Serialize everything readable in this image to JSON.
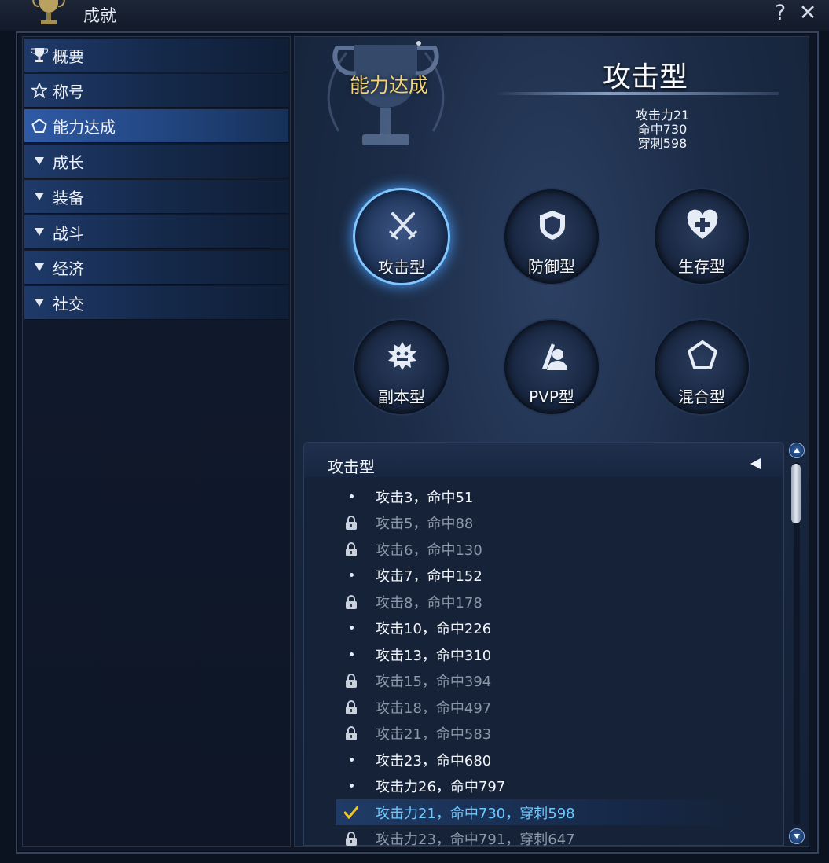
{
  "window": {
    "title": "成就",
    "help_label": "?",
    "close_label": "✕"
  },
  "sidebar": {
    "items": [
      {
        "label": "概要",
        "icon": "trophy-icon"
      },
      {
        "label": "称号",
        "icon": "star-icon"
      },
      {
        "label": "能力达成",
        "icon": "pentagon-icon",
        "active": true
      },
      {
        "label": "成长",
        "icon": "triangle-down-icon"
      },
      {
        "label": "装备",
        "icon": "triangle-down-icon"
      },
      {
        "label": "战斗",
        "icon": "triangle-down-icon"
      },
      {
        "label": "经济",
        "icon": "triangle-down-icon"
      },
      {
        "label": "社交",
        "icon": "triangle-down-icon"
      }
    ]
  },
  "header": {
    "section_name": "能力达成",
    "type_title": "攻击型",
    "stats": [
      "攻击力21",
      "命中730",
      "穿刺598"
    ]
  },
  "types": [
    {
      "label": "攻击型",
      "icon": "crossed-swords-icon",
      "active": true
    },
    {
      "label": "防御型",
      "icon": "shield-icon"
    },
    {
      "label": "生存型",
      "icon": "heart-plus-icon"
    },
    {
      "label": "副本型",
      "icon": "monster-icon"
    },
    {
      "label": "PVP型",
      "icon": "duel-icon"
    },
    {
      "label": "混合型",
      "icon": "pentagon-icon"
    }
  ],
  "list": {
    "title": "攻击型",
    "rows": [
      {
        "text": "攻击3，命中51",
        "status": "open"
      },
      {
        "text": "攻击5，命中88",
        "status": "locked"
      },
      {
        "text": "攻击6，命中130",
        "status": "locked"
      },
      {
        "text": "攻击7，命中152",
        "status": "open"
      },
      {
        "text": "攻击8，命中178",
        "status": "locked"
      },
      {
        "text": "攻击10，命中226",
        "status": "open"
      },
      {
        "text": "攻击13，命中310",
        "status": "open"
      },
      {
        "text": "攻击15，命中394",
        "status": "locked"
      },
      {
        "text": "攻击18，命中497",
        "status": "locked"
      },
      {
        "text": "攻击21，命中583",
        "status": "locked"
      },
      {
        "text": "攻击23，命中680",
        "status": "open"
      },
      {
        "text": "攻击力26，命中797",
        "status": "open"
      },
      {
        "text": "攻击力21，命中730，穿刺598",
        "status": "done"
      },
      {
        "text": "攻击力23，命中791，穿刺647",
        "status": "locked"
      }
    ]
  },
  "colors": {
    "accent": "#2f5aa6",
    "gold": "#f2d27a",
    "done_text": "#6cc8ff",
    "locked_text": "#8d97a8"
  }
}
